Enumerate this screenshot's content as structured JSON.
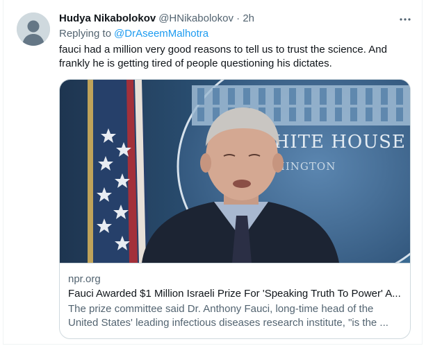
{
  "tweet": {
    "author_name": "Hudya Nikabolokov",
    "author_handle": "@HNikabolokov",
    "separator": "·",
    "time": "2h",
    "replying_to_label": "Replying to",
    "replying_to_handle": "@DrAseemMalhotra",
    "text_lines": [
      "fauci had a million very good reasons to tell us to trust the science. And",
      "frankly he is getting tired of people questioning his dictates."
    ],
    "more_icon": "more-horizontal-icon"
  },
  "card": {
    "image_sign_line1": "WHITE HOUSE",
    "image_sign_line2": "WASHINGTON",
    "domain": "npr.org",
    "title": "Fauci Awarded $1 Million Israeli Prize For 'Speaking Truth To Power' A...",
    "description_lines": [
      "The prize committee said Dr. Anthony Fauci, long-time head of the",
      "United States' leading infectious diseases research institute, \"is the ..."
    ]
  },
  "colors": {
    "link": "#1d9bf0",
    "secondary_text": "#536471",
    "border": "#cfd9de"
  }
}
